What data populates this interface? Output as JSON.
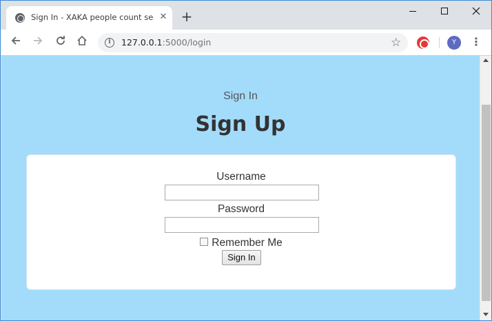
{
  "browser": {
    "tab_title": "Sign In - XAKA people count sen",
    "tab_close": "✕",
    "new_tab": "+",
    "url_host": "127.0.0.1",
    "url_path": ":5000/login",
    "avatar_initial": "Y"
  },
  "page": {
    "subtitle": "Sign In",
    "heading": "Sign Up",
    "form": {
      "username_label": "Username",
      "username_value": "",
      "password_label": "Password",
      "password_value": "",
      "remember_label": "Remember Me",
      "remember_checked": false,
      "submit_label": "Sign In"
    }
  },
  "colors": {
    "page_background": "#a3dcfb",
    "card_background": "#ffffff",
    "heading_text": "#333333"
  },
  "icons": {
    "favicon": "globe-icon",
    "back": "arrow-left-icon",
    "forward": "arrow-right-icon",
    "reload": "reload-icon",
    "home": "home-icon",
    "info": "info-icon",
    "bookmark": "star-icon",
    "extension": "extension-icon",
    "menu": "kebab-menu-icon"
  }
}
